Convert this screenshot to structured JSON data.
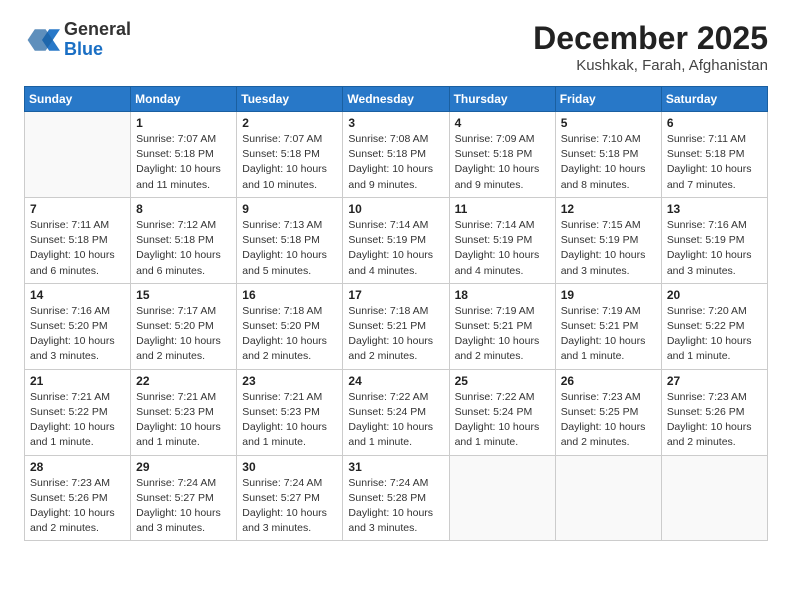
{
  "header": {
    "logo": {
      "general": "General",
      "blue": "Blue"
    },
    "month": "December 2025",
    "location": "Kushkak, Farah, Afghanistan"
  },
  "days_of_week": [
    "Sunday",
    "Monday",
    "Tuesday",
    "Wednesday",
    "Thursday",
    "Friday",
    "Saturday"
  ],
  "weeks": [
    [
      {
        "day": "",
        "info": ""
      },
      {
        "day": "1",
        "info": "Sunrise: 7:07 AM\nSunset: 5:18 PM\nDaylight: 10 hours\nand 11 minutes."
      },
      {
        "day": "2",
        "info": "Sunrise: 7:07 AM\nSunset: 5:18 PM\nDaylight: 10 hours\nand 10 minutes."
      },
      {
        "day": "3",
        "info": "Sunrise: 7:08 AM\nSunset: 5:18 PM\nDaylight: 10 hours\nand 9 minutes."
      },
      {
        "day": "4",
        "info": "Sunrise: 7:09 AM\nSunset: 5:18 PM\nDaylight: 10 hours\nand 9 minutes."
      },
      {
        "day": "5",
        "info": "Sunrise: 7:10 AM\nSunset: 5:18 PM\nDaylight: 10 hours\nand 8 minutes."
      },
      {
        "day": "6",
        "info": "Sunrise: 7:11 AM\nSunset: 5:18 PM\nDaylight: 10 hours\nand 7 minutes."
      }
    ],
    [
      {
        "day": "7",
        "info": "Sunrise: 7:11 AM\nSunset: 5:18 PM\nDaylight: 10 hours\nand 6 minutes."
      },
      {
        "day": "8",
        "info": "Sunrise: 7:12 AM\nSunset: 5:18 PM\nDaylight: 10 hours\nand 6 minutes."
      },
      {
        "day": "9",
        "info": "Sunrise: 7:13 AM\nSunset: 5:18 PM\nDaylight: 10 hours\nand 5 minutes."
      },
      {
        "day": "10",
        "info": "Sunrise: 7:14 AM\nSunset: 5:19 PM\nDaylight: 10 hours\nand 4 minutes."
      },
      {
        "day": "11",
        "info": "Sunrise: 7:14 AM\nSunset: 5:19 PM\nDaylight: 10 hours\nand 4 minutes."
      },
      {
        "day": "12",
        "info": "Sunrise: 7:15 AM\nSunset: 5:19 PM\nDaylight: 10 hours\nand 3 minutes."
      },
      {
        "day": "13",
        "info": "Sunrise: 7:16 AM\nSunset: 5:19 PM\nDaylight: 10 hours\nand 3 minutes."
      }
    ],
    [
      {
        "day": "14",
        "info": "Sunrise: 7:16 AM\nSunset: 5:20 PM\nDaylight: 10 hours\nand 3 minutes."
      },
      {
        "day": "15",
        "info": "Sunrise: 7:17 AM\nSunset: 5:20 PM\nDaylight: 10 hours\nand 2 minutes."
      },
      {
        "day": "16",
        "info": "Sunrise: 7:18 AM\nSunset: 5:20 PM\nDaylight: 10 hours\nand 2 minutes."
      },
      {
        "day": "17",
        "info": "Sunrise: 7:18 AM\nSunset: 5:21 PM\nDaylight: 10 hours\nand 2 minutes."
      },
      {
        "day": "18",
        "info": "Sunrise: 7:19 AM\nSunset: 5:21 PM\nDaylight: 10 hours\nand 2 minutes."
      },
      {
        "day": "19",
        "info": "Sunrise: 7:19 AM\nSunset: 5:21 PM\nDaylight: 10 hours\nand 1 minute."
      },
      {
        "day": "20",
        "info": "Sunrise: 7:20 AM\nSunset: 5:22 PM\nDaylight: 10 hours\nand 1 minute."
      }
    ],
    [
      {
        "day": "21",
        "info": "Sunrise: 7:21 AM\nSunset: 5:22 PM\nDaylight: 10 hours\nand 1 minute."
      },
      {
        "day": "22",
        "info": "Sunrise: 7:21 AM\nSunset: 5:23 PM\nDaylight: 10 hours\nand 1 minute."
      },
      {
        "day": "23",
        "info": "Sunrise: 7:21 AM\nSunset: 5:23 PM\nDaylight: 10 hours\nand 1 minute."
      },
      {
        "day": "24",
        "info": "Sunrise: 7:22 AM\nSunset: 5:24 PM\nDaylight: 10 hours\nand 1 minute."
      },
      {
        "day": "25",
        "info": "Sunrise: 7:22 AM\nSunset: 5:24 PM\nDaylight: 10 hours\nand 1 minute."
      },
      {
        "day": "26",
        "info": "Sunrise: 7:23 AM\nSunset: 5:25 PM\nDaylight: 10 hours\nand 2 minutes."
      },
      {
        "day": "27",
        "info": "Sunrise: 7:23 AM\nSunset: 5:26 PM\nDaylight: 10 hours\nand 2 minutes."
      }
    ],
    [
      {
        "day": "28",
        "info": "Sunrise: 7:23 AM\nSunset: 5:26 PM\nDaylight: 10 hours\nand 2 minutes."
      },
      {
        "day": "29",
        "info": "Sunrise: 7:24 AM\nSunset: 5:27 PM\nDaylight: 10 hours\nand 3 minutes."
      },
      {
        "day": "30",
        "info": "Sunrise: 7:24 AM\nSunset: 5:27 PM\nDaylight: 10 hours\nand 3 minutes."
      },
      {
        "day": "31",
        "info": "Sunrise: 7:24 AM\nSunset: 5:28 PM\nDaylight: 10 hours\nand 3 minutes."
      },
      {
        "day": "",
        "info": ""
      },
      {
        "day": "",
        "info": ""
      },
      {
        "day": "",
        "info": ""
      }
    ]
  ]
}
